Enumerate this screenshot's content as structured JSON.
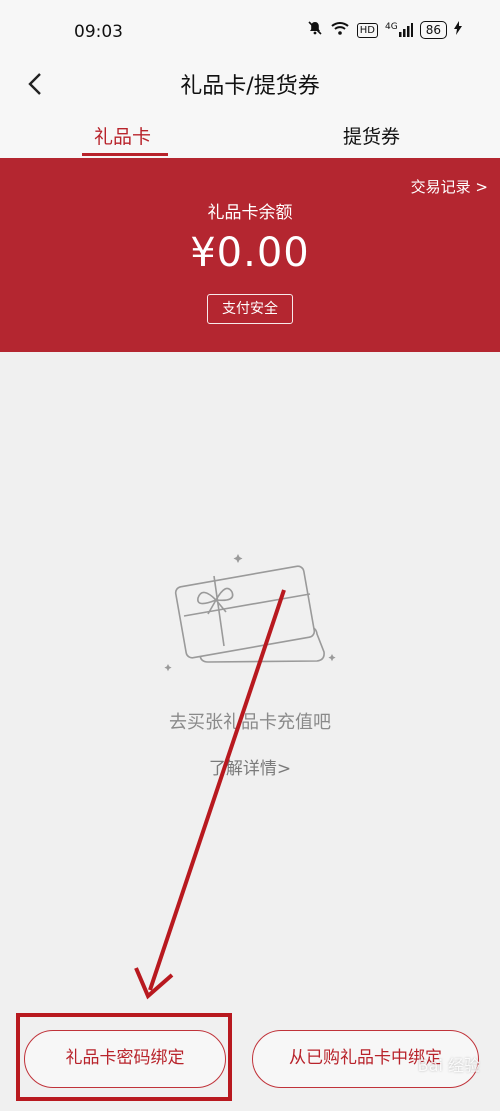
{
  "status_bar": {
    "time": "09:03",
    "network_label": "4G",
    "hd_label": "HD",
    "battery": "86"
  },
  "header": {
    "title": "礼品卡/提货券"
  },
  "tabs": [
    {
      "label": "礼品卡"
    },
    {
      "label": "提货券"
    }
  ],
  "balance": {
    "transaction_link": "交易记录 >",
    "label": "礼品卡余额",
    "amount": "¥0.00",
    "security_button": "支付安全"
  },
  "empty_state": {
    "message": "去买张礼品卡充值吧",
    "link": "了解详情>"
  },
  "actions": {
    "bind_code": "礼品卡密码绑定",
    "bind_purchased": "从已购礼品卡中绑定"
  },
  "watermark": "Bai 经验",
  "colors": {
    "brand_red": "#b42630",
    "annotation_red": "#b8191f"
  }
}
